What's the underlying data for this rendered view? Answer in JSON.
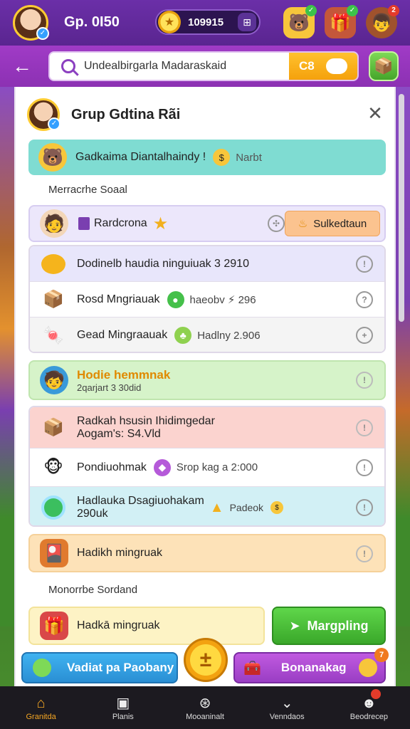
{
  "topbar": {
    "player_label": "Gp. 0I50",
    "coins": "109915",
    "plus_symbol": "⊞",
    "icon_dots": [
      "",
      "",
      "2"
    ]
  },
  "search": {
    "value": "Undealbirgarla Madaraskaid",
    "chip_text": "C8"
  },
  "panel": {
    "title": "Grup Gdtina Rãi",
    "highlight": {
      "text": "Gadkaima Diantalhaindy !",
      "tag": "Narbt"
    },
    "section1": "Merracrhe Soaal",
    "member": {
      "name": "Rardcrona",
      "action": "Sulkedtaun"
    },
    "rows1": [
      {
        "text": "Dodinelb haudia ninguiuak 3 2910",
        "extra": ""
      },
      {
        "text": "Rosd Mngriauak",
        "extra": "haeobv ⚡ 296"
      },
      {
        "text": "Gead Mingraauak",
        "extra": "Hadlny 2.906"
      }
    ],
    "green_card": {
      "title": "Hodie hemmnak",
      "sub": "2qarjart 3 30did"
    },
    "red_card": {
      "title": "Radkah hsusin Ihidimgedar",
      "sub": "Aogam's: S4.Vld"
    },
    "row_mid": {
      "text": "Pondiuohmak",
      "extra": "Srop kag a 2:000"
    },
    "blue_card": {
      "title": "Hadlauka Dsagiuohakam",
      "sub": "290uk",
      "tag": "Padeok"
    },
    "orange_card": {
      "text": "Hadikh mingruak"
    },
    "section2": "Monorrbe Sordand",
    "bottom_card": {
      "text": "Hadkā mingruak"
    },
    "mapping_btn": "Margpling"
  },
  "actions": {
    "left": "Vadiat pa Paobany",
    "right": "Bonanakag",
    "right_badge": "7"
  },
  "nav": [
    {
      "label": "Granitda",
      "icon": "home-icon",
      "active": true
    },
    {
      "label": "Planis",
      "icon": "map-icon",
      "active": false
    },
    {
      "label": "Mooaninalt",
      "icon": "compass-icon",
      "active": false
    },
    {
      "label": "Venndaos",
      "icon": "chevron-icon",
      "active": false
    },
    {
      "label": "Beodrecep",
      "icon": "profile-icon",
      "active": false
    }
  ],
  "colors": {
    "accent_purple": "#7b3fb5",
    "coin_gold": "#f5a10c",
    "card_teal": "#7fdcd2",
    "card_lilac": "#e9e3fb",
    "card_green": "#d6f3c9",
    "card_red": "#fbd3cf",
    "card_blue": "#d2f0f5",
    "card_orange": "#fde2b8",
    "card_yellow": "#fdf3c5"
  }
}
